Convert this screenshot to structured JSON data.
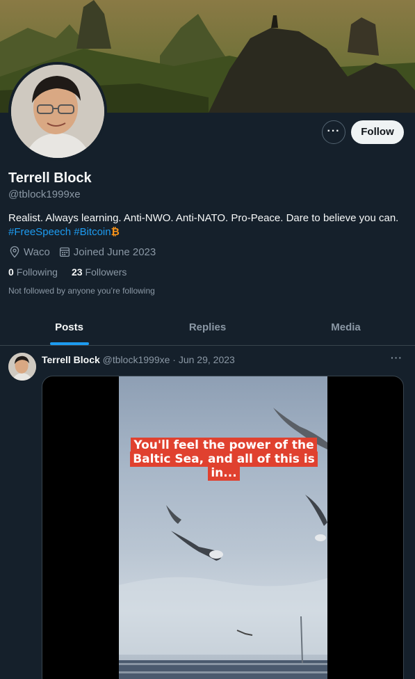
{
  "profile": {
    "name": "Terrell Block",
    "handle": "@tblock1999xe",
    "bio_text": "Realist. Always learning. Anti-NWO. Anti-NATO. Pro-Peace. Dare to believe you can.",
    "hashtags": [
      "#FreeSpeech",
      "#Bitcoin"
    ],
    "bitcoin_symbol": "₿",
    "location": "Waco",
    "joined": "Joined June 2023",
    "following_count": "0",
    "following_label": "Following",
    "followers_count": "23",
    "followers_label": "Followers",
    "not_followed_note": "Not followed by anyone you’re following"
  },
  "actions": {
    "more_label": "···",
    "follow_label": "Follow"
  },
  "tabs": [
    {
      "label": "Posts",
      "active": true
    },
    {
      "label": "Replies",
      "active": false
    },
    {
      "label": "Media",
      "active": false
    }
  ],
  "tweet": {
    "author_name": "Terrell Block",
    "author_handle": "@tblock1999xe",
    "separator": "·",
    "date": "Jun 29, 2023",
    "more_label": "···",
    "video_caption": "You'll feel the power of the Baltic Sea, and all of this is in..."
  },
  "colors": {
    "background": "#15202b",
    "accent": "#1d9bf0",
    "muted_text": "#8b98a5",
    "caption_bg": "#e0412f",
    "bitcoin": "#f7931a"
  },
  "icons": {
    "location": "location-pin-icon",
    "calendar": "calendar-icon"
  }
}
